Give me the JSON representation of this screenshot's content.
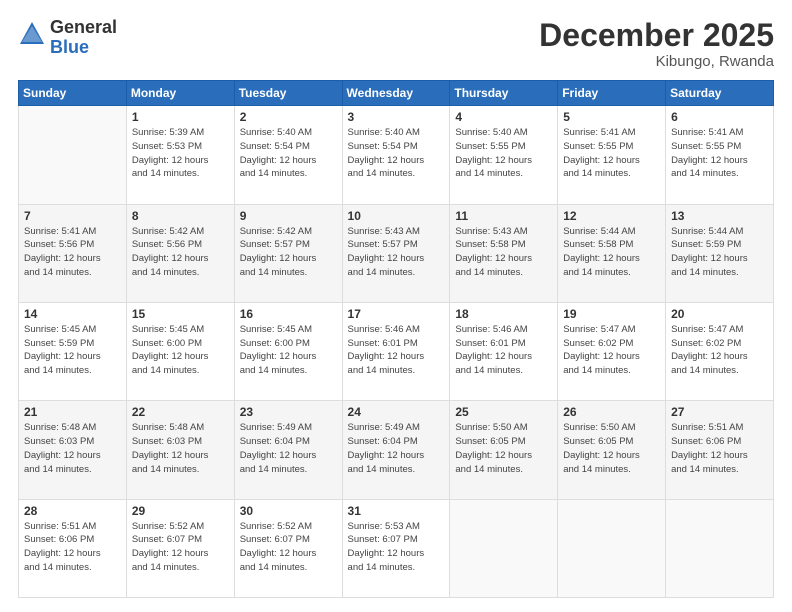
{
  "logo": {
    "general": "General",
    "blue": "Blue"
  },
  "title": "December 2025",
  "subtitle": "Kibungo, Rwanda",
  "days_header": [
    "Sunday",
    "Monday",
    "Tuesday",
    "Wednesday",
    "Thursday",
    "Friday",
    "Saturday"
  ],
  "weeks": [
    [
      {
        "num": "",
        "info": ""
      },
      {
        "num": "1",
        "info": "Sunrise: 5:39 AM\nSunset: 5:53 PM\nDaylight: 12 hours\nand 14 minutes."
      },
      {
        "num": "2",
        "info": "Sunrise: 5:40 AM\nSunset: 5:54 PM\nDaylight: 12 hours\nand 14 minutes."
      },
      {
        "num": "3",
        "info": "Sunrise: 5:40 AM\nSunset: 5:54 PM\nDaylight: 12 hours\nand 14 minutes."
      },
      {
        "num": "4",
        "info": "Sunrise: 5:40 AM\nSunset: 5:55 PM\nDaylight: 12 hours\nand 14 minutes."
      },
      {
        "num": "5",
        "info": "Sunrise: 5:41 AM\nSunset: 5:55 PM\nDaylight: 12 hours\nand 14 minutes."
      },
      {
        "num": "6",
        "info": "Sunrise: 5:41 AM\nSunset: 5:55 PM\nDaylight: 12 hours\nand 14 minutes."
      }
    ],
    [
      {
        "num": "7",
        "info": "Sunrise: 5:41 AM\nSunset: 5:56 PM\nDaylight: 12 hours\nand 14 minutes."
      },
      {
        "num": "8",
        "info": "Sunrise: 5:42 AM\nSunset: 5:56 PM\nDaylight: 12 hours\nand 14 minutes."
      },
      {
        "num": "9",
        "info": "Sunrise: 5:42 AM\nSunset: 5:57 PM\nDaylight: 12 hours\nand 14 minutes."
      },
      {
        "num": "10",
        "info": "Sunrise: 5:43 AM\nSunset: 5:57 PM\nDaylight: 12 hours\nand 14 minutes."
      },
      {
        "num": "11",
        "info": "Sunrise: 5:43 AM\nSunset: 5:58 PM\nDaylight: 12 hours\nand 14 minutes."
      },
      {
        "num": "12",
        "info": "Sunrise: 5:44 AM\nSunset: 5:58 PM\nDaylight: 12 hours\nand 14 minutes."
      },
      {
        "num": "13",
        "info": "Sunrise: 5:44 AM\nSunset: 5:59 PM\nDaylight: 12 hours\nand 14 minutes."
      }
    ],
    [
      {
        "num": "14",
        "info": "Sunrise: 5:45 AM\nSunset: 5:59 PM\nDaylight: 12 hours\nand 14 minutes."
      },
      {
        "num": "15",
        "info": "Sunrise: 5:45 AM\nSunset: 6:00 PM\nDaylight: 12 hours\nand 14 minutes."
      },
      {
        "num": "16",
        "info": "Sunrise: 5:45 AM\nSunset: 6:00 PM\nDaylight: 12 hours\nand 14 minutes."
      },
      {
        "num": "17",
        "info": "Sunrise: 5:46 AM\nSunset: 6:01 PM\nDaylight: 12 hours\nand 14 minutes."
      },
      {
        "num": "18",
        "info": "Sunrise: 5:46 AM\nSunset: 6:01 PM\nDaylight: 12 hours\nand 14 minutes."
      },
      {
        "num": "19",
        "info": "Sunrise: 5:47 AM\nSunset: 6:02 PM\nDaylight: 12 hours\nand 14 minutes."
      },
      {
        "num": "20",
        "info": "Sunrise: 5:47 AM\nSunset: 6:02 PM\nDaylight: 12 hours\nand 14 minutes."
      }
    ],
    [
      {
        "num": "21",
        "info": "Sunrise: 5:48 AM\nSunset: 6:03 PM\nDaylight: 12 hours\nand 14 minutes."
      },
      {
        "num": "22",
        "info": "Sunrise: 5:48 AM\nSunset: 6:03 PM\nDaylight: 12 hours\nand 14 minutes."
      },
      {
        "num": "23",
        "info": "Sunrise: 5:49 AM\nSunset: 6:04 PM\nDaylight: 12 hours\nand 14 minutes."
      },
      {
        "num": "24",
        "info": "Sunrise: 5:49 AM\nSunset: 6:04 PM\nDaylight: 12 hours\nand 14 minutes."
      },
      {
        "num": "25",
        "info": "Sunrise: 5:50 AM\nSunset: 6:05 PM\nDaylight: 12 hours\nand 14 minutes."
      },
      {
        "num": "26",
        "info": "Sunrise: 5:50 AM\nSunset: 6:05 PM\nDaylight: 12 hours\nand 14 minutes."
      },
      {
        "num": "27",
        "info": "Sunrise: 5:51 AM\nSunset: 6:06 PM\nDaylight: 12 hours\nand 14 minutes."
      }
    ],
    [
      {
        "num": "28",
        "info": "Sunrise: 5:51 AM\nSunset: 6:06 PM\nDaylight: 12 hours\nand 14 minutes."
      },
      {
        "num": "29",
        "info": "Sunrise: 5:52 AM\nSunset: 6:07 PM\nDaylight: 12 hours\nand 14 minutes."
      },
      {
        "num": "30",
        "info": "Sunrise: 5:52 AM\nSunset: 6:07 PM\nDaylight: 12 hours\nand 14 minutes."
      },
      {
        "num": "31",
        "info": "Sunrise: 5:53 AM\nSunset: 6:07 PM\nDaylight: 12 hours\nand 14 minutes."
      },
      {
        "num": "",
        "info": ""
      },
      {
        "num": "",
        "info": ""
      },
      {
        "num": "",
        "info": ""
      }
    ]
  ]
}
